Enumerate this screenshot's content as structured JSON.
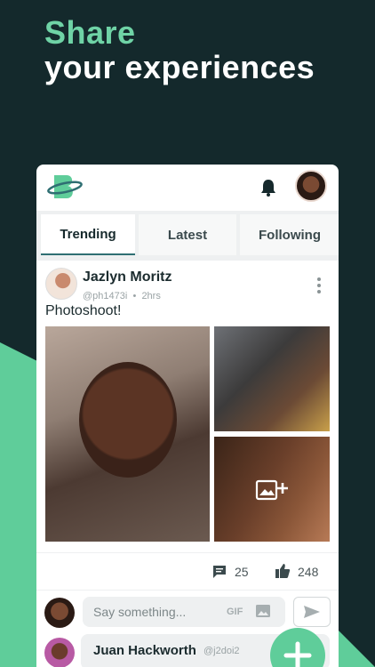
{
  "headline": {
    "line1": "Share",
    "line2": "your experiences"
  },
  "tabs": [
    {
      "label": "Trending",
      "active": true
    },
    {
      "label": "Latest",
      "active": false
    },
    {
      "label": "Following",
      "active": false
    }
  ],
  "post": {
    "author": "Jazlyn Moritz",
    "handle": "@ph1473i",
    "separator": "•",
    "time": "2hrs",
    "text": "Photoshoot!",
    "comments": "25",
    "likes": "248"
  },
  "composer": {
    "placeholder": "Say something...",
    "gif_label": "GIF"
  },
  "reply": {
    "author": "Juan Hackworth",
    "handle": "@j2doi2"
  },
  "colors": {
    "background": "#14292c",
    "accent": "#5fcd9a",
    "accent_text": "#6fd3a6"
  },
  "icons": [
    "brand-logo-icon",
    "bell-icon",
    "kebab-menu-icon",
    "add-photo-icon",
    "comment-icon",
    "thumbs-up-icon",
    "image-icon",
    "send-icon",
    "plus-icon"
  ]
}
